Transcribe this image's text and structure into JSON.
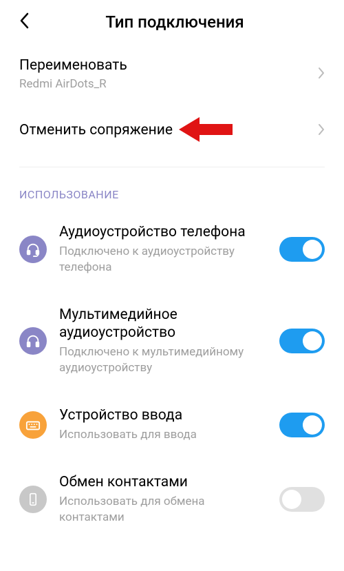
{
  "header": {
    "title": "Тип подключения"
  },
  "rename": {
    "label": "Переименовать",
    "value": "Redmi AirDots_R"
  },
  "unpair": {
    "label": "Отменить сопряжение"
  },
  "section": {
    "usage_label": "ИСПОЛЬЗОВАНИЕ"
  },
  "usage": [
    {
      "title": "Аудиоустройство телефона",
      "subtitle": "Подключено к аудиоустройству телефона",
      "icon": "headset-icon",
      "icon_color": "#8a86c6",
      "enabled": true
    },
    {
      "title": "Мультимедийное аудиоустройство",
      "subtitle": "Подключено к мультимедийному аудиоустройству",
      "icon": "headphones-icon",
      "icon_color": "#8a86c6",
      "enabled": true
    },
    {
      "title": "Устройство ввода",
      "subtitle": "Использовать для ввода",
      "icon": "keyboard-icon",
      "icon_color": "#f8a23a",
      "enabled": true
    },
    {
      "title": "Обмен контактами",
      "subtitle": "Использовать для обмена контактами",
      "icon": "phone-icon",
      "icon_color": "#c8c8c8",
      "enabled": false
    }
  ],
  "annotation": {
    "arrow_color": "#e01414"
  }
}
